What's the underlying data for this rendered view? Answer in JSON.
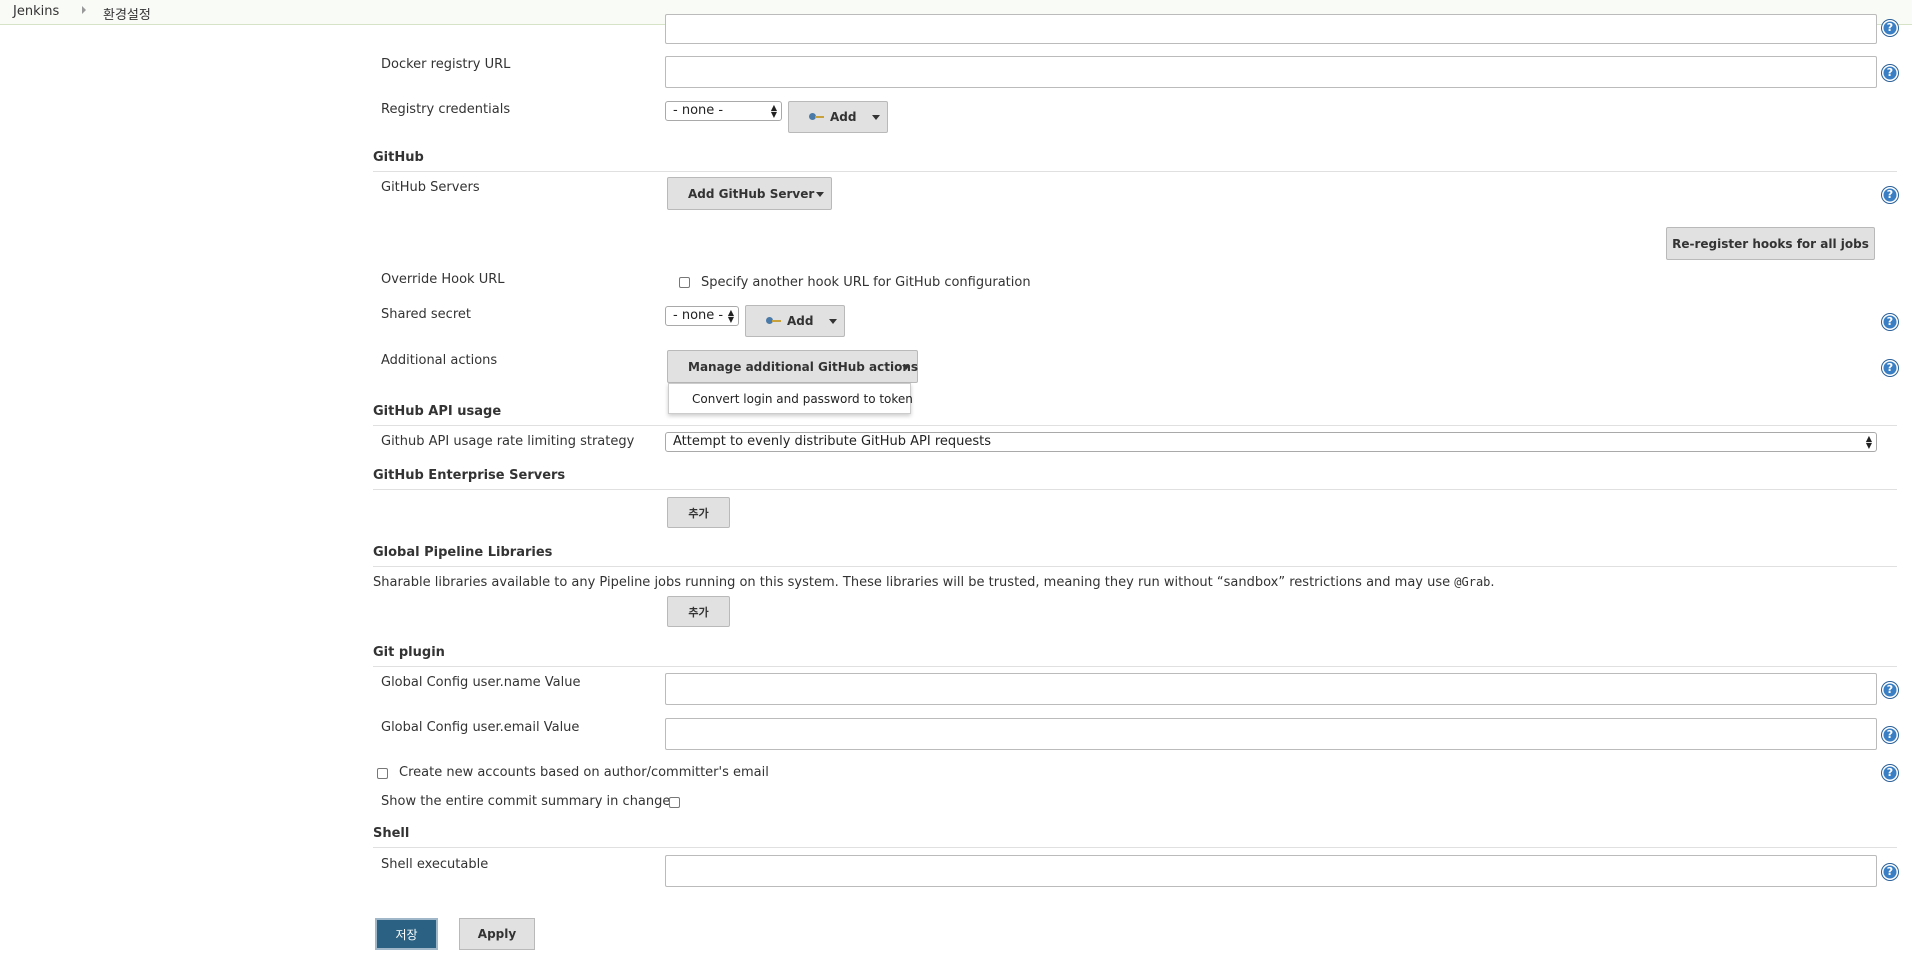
{
  "breadcrumb": {
    "items": [
      "Jenkins",
      "환경설정"
    ]
  },
  "docker": {
    "registry_url_label": "Docker registry URL",
    "registry_url_value": "",
    "credentials_label": "Registry credentials",
    "credentials_selected": "- none -",
    "add_label": "Add"
  },
  "github": {
    "section_title": "GitHub",
    "servers_label": "GitHub Servers",
    "add_server_label": "Add GitHub Server",
    "reregister_label": "Re-register hooks for all jobs",
    "override_label": "Override Hook URL",
    "override_checkbox_label": "Specify another hook URL for GitHub configuration",
    "override_checked": false,
    "shared_secret_label": "Shared secret",
    "shared_secret_selected": "- none -",
    "add_label": "Add",
    "additional_actions_label": "Additional actions",
    "manage_actions_label": "Manage additional GitHub actions",
    "dropdown_items": [
      "Convert login and password to token"
    ]
  },
  "github_api": {
    "section_title": "GitHub API usage",
    "strategy_label": "Github API usage rate limiting strategy",
    "strategy_selected": "Attempt to evenly distribute GitHub API requests"
  },
  "github_enterprise": {
    "section_title": "GitHub Enterprise Servers",
    "add_label": "추가"
  },
  "pipeline_libraries": {
    "section_title": "Global Pipeline Libraries",
    "description_text": "Sharable libraries available to any Pipeline jobs running on this system. These libraries will be trusted, meaning they run without “sandbox” restrictions and may use",
    "description_code": "@Grab",
    "description_end": ".",
    "add_label": "추가"
  },
  "git_plugin": {
    "section_title": "Git plugin",
    "username_label": "Global Config user.name Value",
    "username_value": "",
    "email_label": "Global Config user.email Value",
    "email_value": "",
    "create_accounts_label": "Create new accounts based on author/committer's email",
    "create_accounts_checked": false,
    "show_summary_label": "Show the entire commit summary in changes",
    "show_summary_checked": false
  },
  "shell": {
    "section_title": "Shell",
    "executable_label": "Shell executable",
    "executable_value": ""
  },
  "footer": {
    "save_label": "저장",
    "apply_label": "Apply"
  },
  "help_glyph": "?",
  "colors": {
    "primary_button": "#2b6283",
    "help_icon": "#3a7fc4",
    "breadcrumb_bg": "#f9fbf6"
  }
}
